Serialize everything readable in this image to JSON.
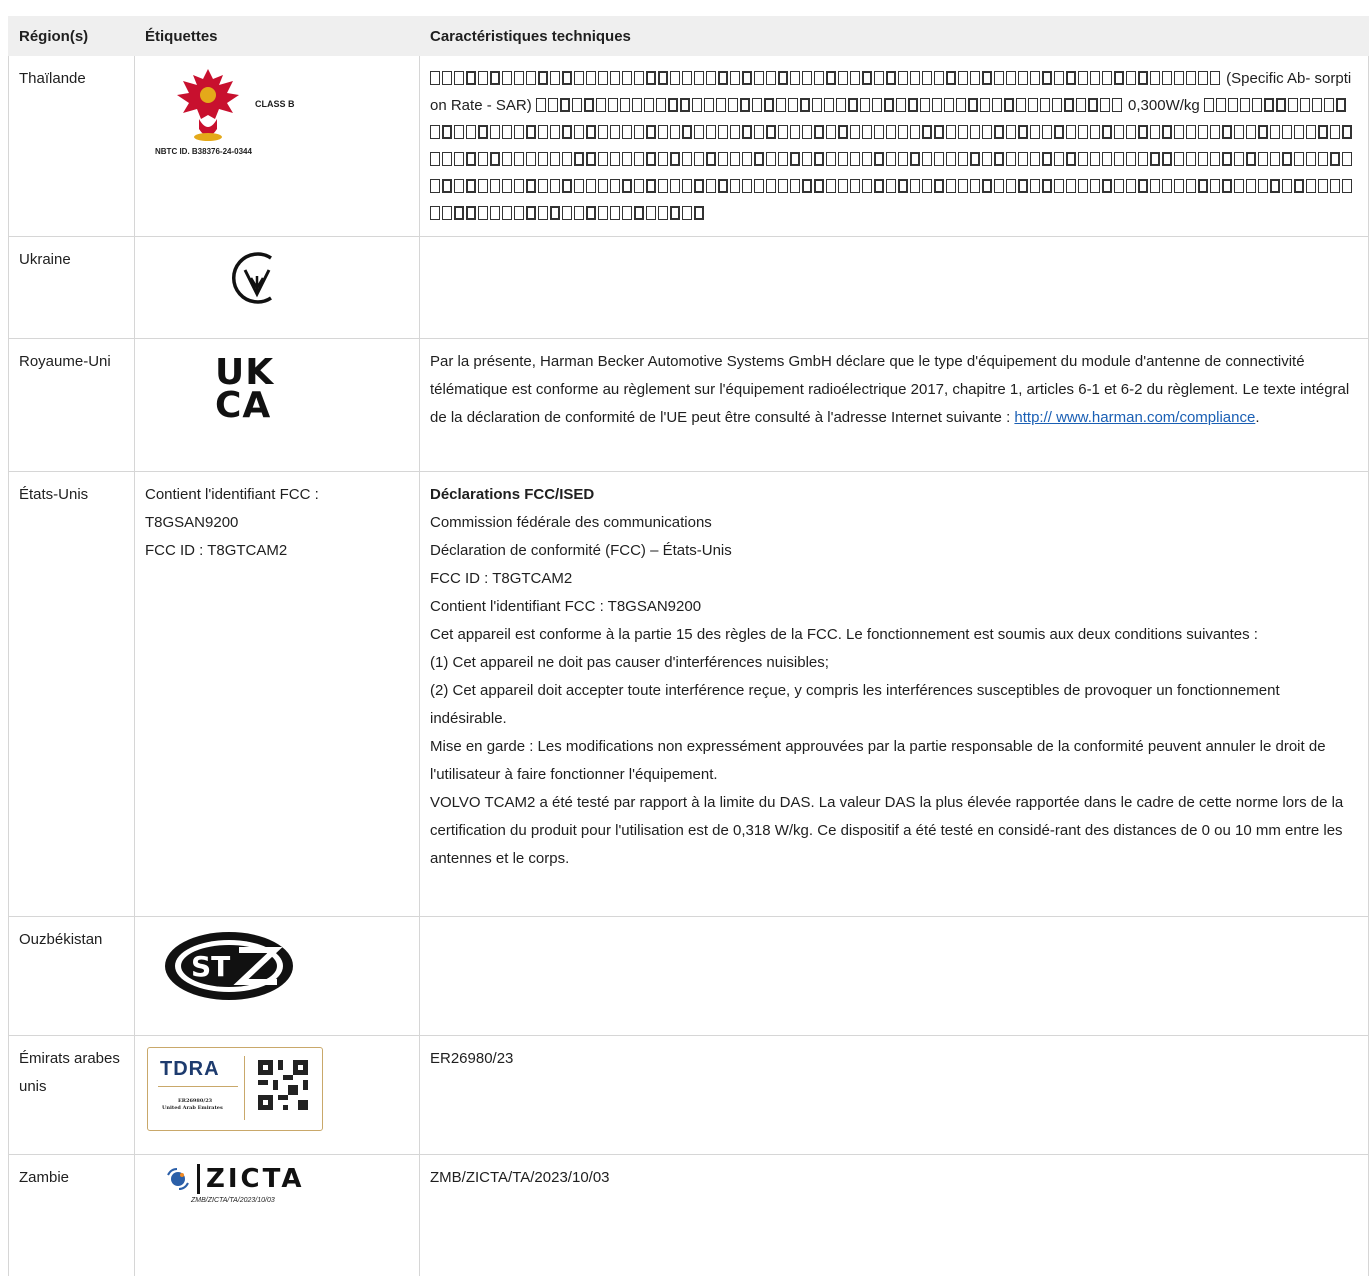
{
  "headers": {
    "region": "Région(s)",
    "labels": "Étiquettes",
    "specs": "Caractéristiques techniques"
  },
  "thailand": {
    "region": "Thaïlande",
    "logo_class": "CLASS B",
    "logo_id": "NBTC ID. B38376-24-0344",
    "sar_text_1": "(Specific Ab-",
    "sar_text_2": "sorption Rate - SAR)",
    "sar_value": "0,300W/kg",
    "icon": "garuda-emblem-icon"
  },
  "ukraine": {
    "region": "Ukraine",
    "icon": "ukraine-conformity-mark-icon"
  },
  "uk": {
    "region": "Royaume-Uni",
    "logo_line1": "UK",
    "logo_line2": "CA",
    "text": "Par la présente, Harman Becker Automotive Systems GmbH déclare que le type d'équipement du module d'antenne de connectivité télématique est conforme au règlement sur l'équipement radioélectrique 2017, chapitre 1, articles 6-1 et 6-2 du règlement. Le texte intégral de la déclaration de conformité de l'UE peut être consulté à l'adresse Internet suivante :",
    "link": "http:// www.harman.com/compliance",
    "link_suffix": "."
  },
  "usa": {
    "region": "États-Unis",
    "label_line1": "Contient l'identifiant FCC :",
    "label_line2": "T8GSAN9200",
    "label_line3": "FCC ID : T8GTCAM2",
    "heading": "Déclarations FCC/ISED",
    "lines": [
      "Commission fédérale des communications",
      "Déclaration de conformité (FCC) – États-Unis",
      "FCC ID : T8GTCAM2",
      "Contient l'identifiant FCC : T8GSAN9200",
      "Cet appareil est conforme à la partie 15 des règles de la FCC. Le fonctionnement est soumis aux deux conditions suivantes :",
      "(1) Cet appareil ne doit pas causer d'interférences nuisibles;",
      "(2) Cet appareil doit accepter toute interférence reçue, y compris les interférences susceptibles de provoquer un fonctionnement indésirable.",
      "Mise en garde : Les modifications non expressément approuvées par la partie responsable de la conformité peuvent annuler le droit de l'utilisateur à faire fonctionner l'équipement.",
      "VOLVO TCAM2 a été testé par rapport à la limite du DAS. La valeur DAS la plus élevée rapportée dans le cadre de cette norme lors de la certification du produit pour l'utilisation est de 0,318 W/kg. Ce dispositif a été testé en considé-rant des distances de 0 ou 10 mm entre les antennes et le corps."
    ]
  },
  "uzbekistan": {
    "region": "Ouzbékistan",
    "logo_text": "ST",
    "icon": "uzbekistan-stz-mark-icon"
  },
  "uae": {
    "region": "Émirats arabes unis",
    "logo_brand": "TDRA",
    "logo_code": "ER26980/23",
    "logo_country": "United Arab Emirates",
    "spec": "ER26980/23",
    "icon": "qr-code-icon"
  },
  "zambia": {
    "region": "Zambie",
    "logo_brand": "ZICTA",
    "logo_code": "ZMB/ZICTA/TA/2023/10/03",
    "spec": "ZMB/ZICTA/TA/2023/10/03",
    "icon": "zicta-logo-icon"
  }
}
